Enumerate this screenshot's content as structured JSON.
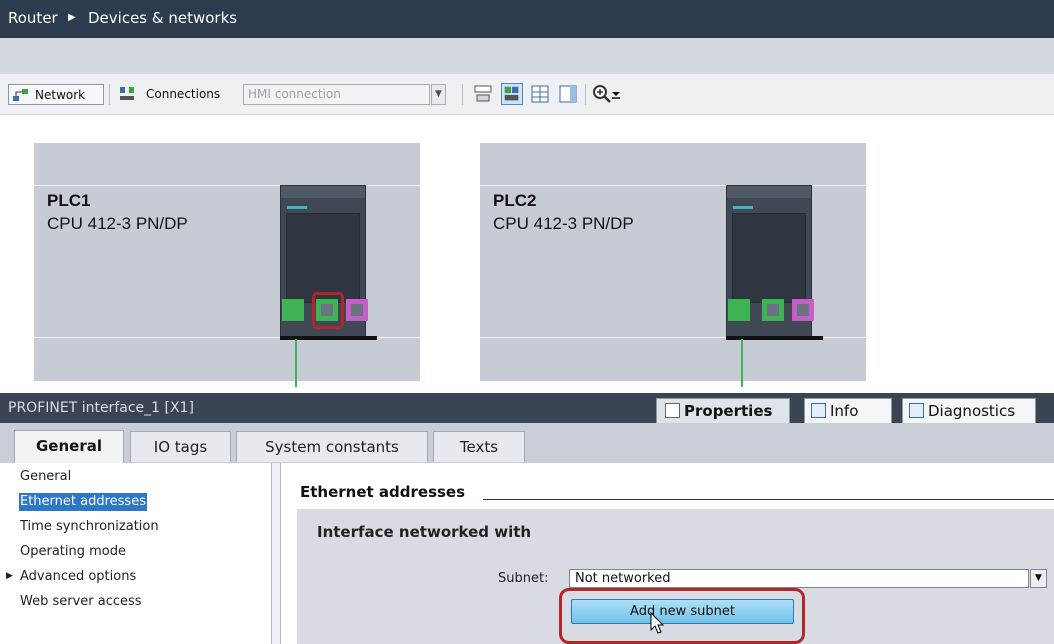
{
  "breadcrumb": {
    "project": "Router",
    "separator": "▶",
    "page": "Devices & networks"
  },
  "toolbar": {
    "network_label": "Network",
    "connections_label": "Connections",
    "connection_type_value": "HMI connection",
    "icons": [
      "network-view-icon",
      "connections-icon",
      "dropdown-icon",
      "show-names-icon",
      "address-view-icon",
      "grid-icon",
      "panel-icon",
      "zoom-icon",
      "zoom-dropdown-icon"
    ]
  },
  "devices": [
    {
      "name": "PLC1",
      "cpu": "CPU 412-3 PN/DP",
      "selected_port": "port-2"
    },
    {
      "name": "PLC2",
      "cpu": "CPU 412-3 PN/DP"
    }
  ],
  "inspector": {
    "title": "PROFINET interface_1 [X1]",
    "tabs": [
      {
        "label": "Properties",
        "icon": "properties-icon",
        "active": true
      },
      {
        "label": "Info",
        "icon": "info-icon"
      },
      {
        "label": "Diagnostics",
        "icon": "diagnostics-icon"
      }
    ],
    "subtabs": [
      "General",
      "IO tags",
      "System constants",
      "Texts"
    ],
    "nav": [
      {
        "label": "General"
      },
      {
        "label": "Ethernet addresses",
        "selected": true
      },
      {
        "label": "Time synchronization"
      },
      {
        "label": "Operating mode"
      },
      {
        "label": "Advanced options",
        "expander": "▶"
      },
      {
        "label": "Web server access"
      }
    ],
    "section_title": "Ethernet addresses",
    "group_title": "Interface networked with",
    "subnet_label": "Subnet:",
    "subnet_value": "Not networked",
    "add_subnet_label": "Add new subnet"
  },
  "colors": {
    "title_bar": "#2c3b4d",
    "device_body": "#3f4854",
    "port_green": "#3fb454",
    "port_pink": "#c45fc7",
    "highlight_red": "#b3262b",
    "selection_blue": "#2c77c9"
  }
}
